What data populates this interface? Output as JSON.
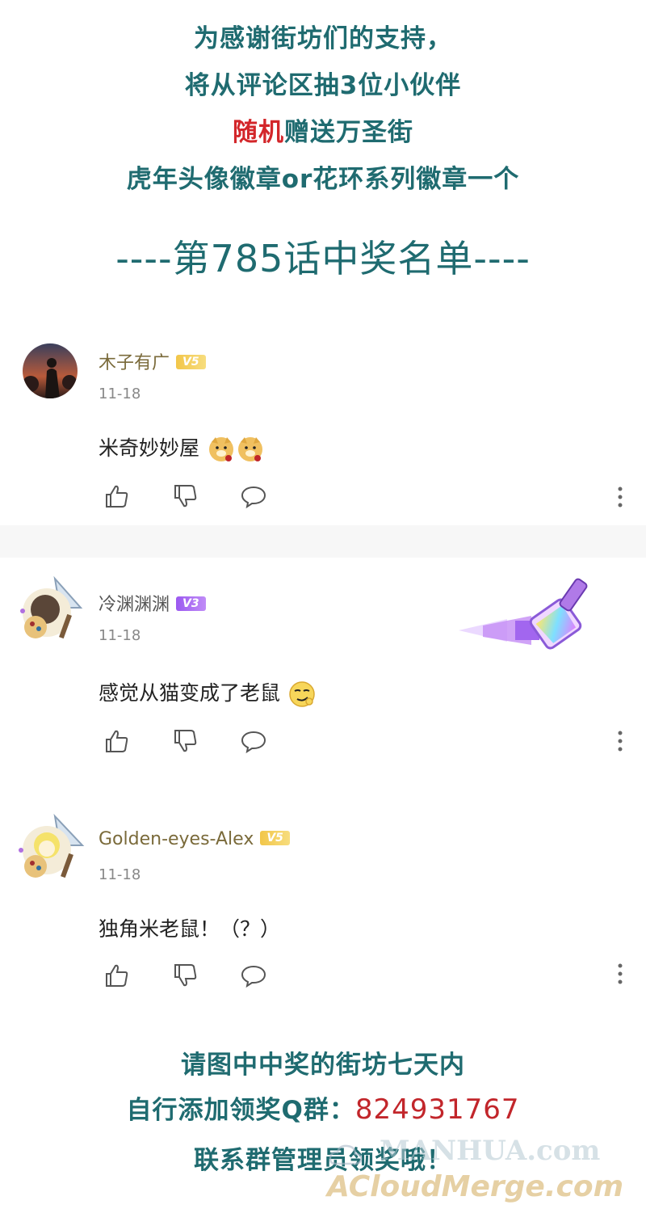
{
  "header": {
    "line1": "为感谢街坊们的支持，",
    "line2": "将从评论区抽3位小伙伴",
    "line3_red": "随机",
    "line3_rest": "赠送万圣街",
    "line4": "虎年头像徽章or花环系列徽章一个",
    "title": "----第785话中奖名单----"
  },
  "comments": [
    {
      "username": "木子有广",
      "level": "V5",
      "date": "11-18",
      "text": "米奇妙妙屋",
      "emoji": "doge-rose-icon"
    },
    {
      "username": "冷渊渊渊",
      "level": "V3",
      "date": "11-18",
      "text": "感觉从猫变成了老鼠",
      "emoji": "smirk-face-icon"
    },
    {
      "username": "Golden-eyes-Alex",
      "level": "V5",
      "date": "11-18",
      "text": "独角米老鼠！（？）",
      "emoji": ""
    }
  ],
  "footer": {
    "line1": "请图中中奖的街坊七天内",
    "line2_prefix": "自行添加领奖Q群：",
    "line2_number": "824931767",
    "line3": "联系群管理员领奖哦！"
  },
  "watermark": {
    "line1": "MANHUA.com",
    "line2": "ACloudMerge.com"
  },
  "colors": {
    "teal": "#1f6b70",
    "red": "#d3262a",
    "v5_badge": "#f2c649",
    "v3_badge": "#9b59f0"
  }
}
